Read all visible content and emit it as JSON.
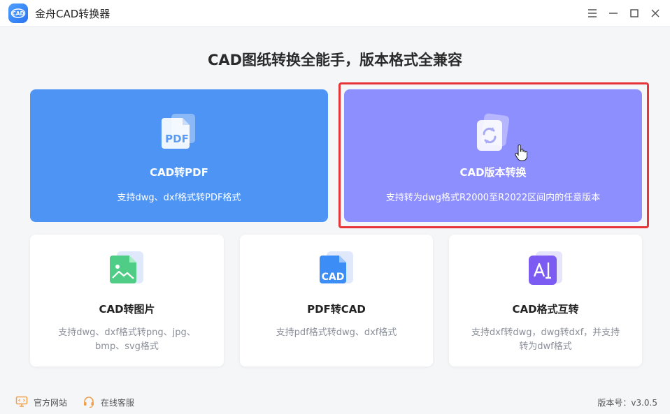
{
  "window": {
    "title": "金舟CAD转换器",
    "logo_text": "CAD"
  },
  "headline": "CAD图纸转换全能手，版本格式全兼容",
  "cards": {
    "cad_to_pdf": {
      "title": "CAD转PDF",
      "desc": "支持dwg、dxf格式转PDF格式",
      "icon_text": "PDF"
    },
    "cad_version": {
      "title": "CAD版本转换",
      "desc": "支持转为dwg格式R2000至R2022区间内的任意版本"
    },
    "cad_to_image": {
      "title": "CAD转图片",
      "desc": "支持dwg、dxf格式转png、jpg、bmp、svg格式"
    },
    "pdf_to_cad": {
      "title": "PDF转CAD",
      "desc": "支持pdf格式转dwg、dxf格式",
      "icon_text": "CAD"
    },
    "cad_format": {
      "title": "CAD格式互转",
      "desc": "支持dxf转dwg，dwg转dxf，并支持转为dwf格式"
    }
  },
  "footer": {
    "website": "官方网站",
    "support": "在线客服",
    "version": "版本号：v3.0.5"
  },
  "colors": {
    "card_pdf": "#4e94f5",
    "card_version": "#8e8ffe",
    "selection": "#e53539"
  }
}
